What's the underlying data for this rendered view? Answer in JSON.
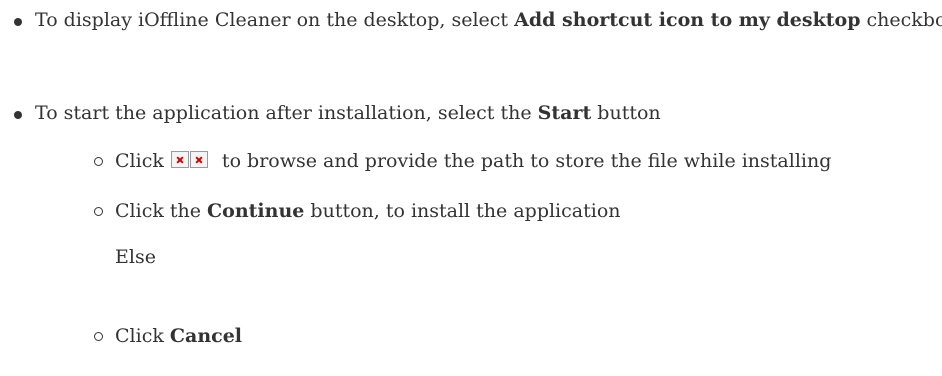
{
  "items": [
    {
      "pre": "To display iOffline Cleaner on the desktop, select ",
      "bold": "Add shortcut icon to my desktop",
      "post": " checkbox"
    },
    {
      "pre": "To start the application after installation, select the ",
      "bold": "Start",
      "post": " button"
    }
  ],
  "subitems": {
    "browse": {
      "pre": "Click ",
      "icons": [
        "broken-image-icon",
        "broken-image-icon"
      ],
      "post": " to browse and provide the path to store the file while installing"
    },
    "continue": {
      "pre": "Click the ",
      "bold": "Continue",
      "post": " button, to install the application",
      "else": "Else"
    },
    "cancel": {
      "pre": "Click ",
      "bold": "Cancel"
    }
  }
}
